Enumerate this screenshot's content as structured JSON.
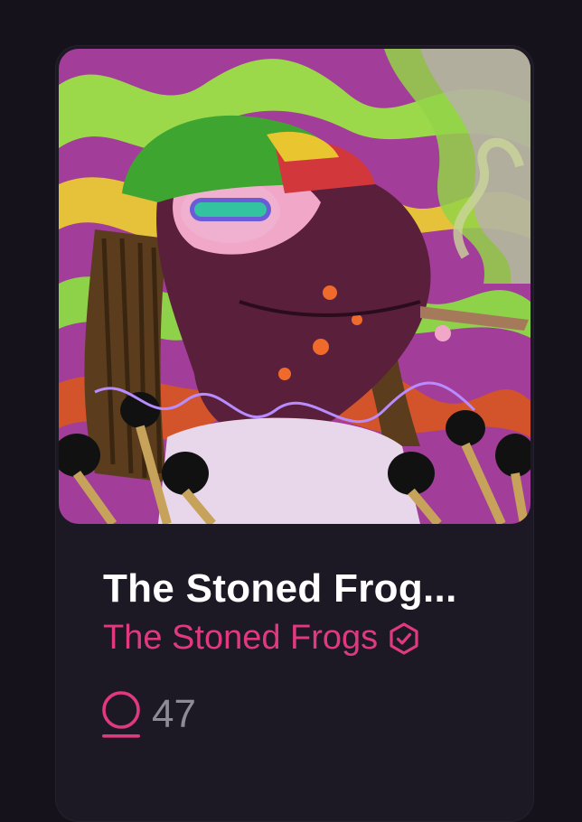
{
  "card": {
    "title": "The Stoned Frog...",
    "collection": "The Stoned Frogs",
    "likes": "47"
  },
  "icons": {
    "verified": "verified-badge-icon",
    "like": "circle-like-icon"
  },
  "colors": {
    "background": "#15121c",
    "card": "#1c1824",
    "accent": "#e0397f",
    "title": "#ffffff",
    "muted": "#8e8a96"
  }
}
